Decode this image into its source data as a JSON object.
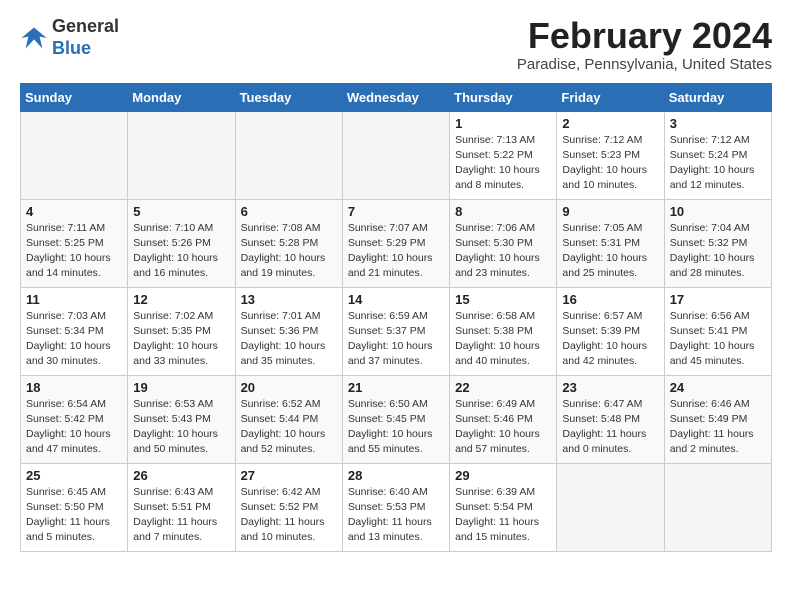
{
  "header": {
    "logo_line1": "General",
    "logo_line2": "Blue",
    "month": "February 2024",
    "location": "Paradise, Pennsylvania, United States"
  },
  "days_of_week": [
    "Sunday",
    "Monday",
    "Tuesday",
    "Wednesday",
    "Thursday",
    "Friday",
    "Saturday"
  ],
  "weeks": [
    [
      {
        "num": "",
        "info": "",
        "empty": true
      },
      {
        "num": "",
        "info": "",
        "empty": true
      },
      {
        "num": "",
        "info": "",
        "empty": true
      },
      {
        "num": "",
        "info": "",
        "empty": true
      },
      {
        "num": "1",
        "info": "Sunrise: 7:13 AM\nSunset: 5:22 PM\nDaylight: 10 hours\nand 8 minutes."
      },
      {
        "num": "2",
        "info": "Sunrise: 7:12 AM\nSunset: 5:23 PM\nDaylight: 10 hours\nand 10 minutes."
      },
      {
        "num": "3",
        "info": "Sunrise: 7:12 AM\nSunset: 5:24 PM\nDaylight: 10 hours\nand 12 minutes."
      }
    ],
    [
      {
        "num": "4",
        "info": "Sunrise: 7:11 AM\nSunset: 5:25 PM\nDaylight: 10 hours\nand 14 minutes."
      },
      {
        "num": "5",
        "info": "Sunrise: 7:10 AM\nSunset: 5:26 PM\nDaylight: 10 hours\nand 16 minutes."
      },
      {
        "num": "6",
        "info": "Sunrise: 7:08 AM\nSunset: 5:28 PM\nDaylight: 10 hours\nand 19 minutes."
      },
      {
        "num": "7",
        "info": "Sunrise: 7:07 AM\nSunset: 5:29 PM\nDaylight: 10 hours\nand 21 minutes."
      },
      {
        "num": "8",
        "info": "Sunrise: 7:06 AM\nSunset: 5:30 PM\nDaylight: 10 hours\nand 23 minutes."
      },
      {
        "num": "9",
        "info": "Sunrise: 7:05 AM\nSunset: 5:31 PM\nDaylight: 10 hours\nand 25 minutes."
      },
      {
        "num": "10",
        "info": "Sunrise: 7:04 AM\nSunset: 5:32 PM\nDaylight: 10 hours\nand 28 minutes."
      }
    ],
    [
      {
        "num": "11",
        "info": "Sunrise: 7:03 AM\nSunset: 5:34 PM\nDaylight: 10 hours\nand 30 minutes."
      },
      {
        "num": "12",
        "info": "Sunrise: 7:02 AM\nSunset: 5:35 PM\nDaylight: 10 hours\nand 33 minutes."
      },
      {
        "num": "13",
        "info": "Sunrise: 7:01 AM\nSunset: 5:36 PM\nDaylight: 10 hours\nand 35 minutes."
      },
      {
        "num": "14",
        "info": "Sunrise: 6:59 AM\nSunset: 5:37 PM\nDaylight: 10 hours\nand 37 minutes."
      },
      {
        "num": "15",
        "info": "Sunrise: 6:58 AM\nSunset: 5:38 PM\nDaylight: 10 hours\nand 40 minutes."
      },
      {
        "num": "16",
        "info": "Sunrise: 6:57 AM\nSunset: 5:39 PM\nDaylight: 10 hours\nand 42 minutes."
      },
      {
        "num": "17",
        "info": "Sunrise: 6:56 AM\nSunset: 5:41 PM\nDaylight: 10 hours\nand 45 minutes."
      }
    ],
    [
      {
        "num": "18",
        "info": "Sunrise: 6:54 AM\nSunset: 5:42 PM\nDaylight: 10 hours\nand 47 minutes."
      },
      {
        "num": "19",
        "info": "Sunrise: 6:53 AM\nSunset: 5:43 PM\nDaylight: 10 hours\nand 50 minutes."
      },
      {
        "num": "20",
        "info": "Sunrise: 6:52 AM\nSunset: 5:44 PM\nDaylight: 10 hours\nand 52 minutes."
      },
      {
        "num": "21",
        "info": "Sunrise: 6:50 AM\nSunset: 5:45 PM\nDaylight: 10 hours\nand 55 minutes."
      },
      {
        "num": "22",
        "info": "Sunrise: 6:49 AM\nSunset: 5:46 PM\nDaylight: 10 hours\nand 57 minutes."
      },
      {
        "num": "23",
        "info": "Sunrise: 6:47 AM\nSunset: 5:48 PM\nDaylight: 11 hours\nand 0 minutes."
      },
      {
        "num": "24",
        "info": "Sunrise: 6:46 AM\nSunset: 5:49 PM\nDaylight: 11 hours\nand 2 minutes."
      }
    ],
    [
      {
        "num": "25",
        "info": "Sunrise: 6:45 AM\nSunset: 5:50 PM\nDaylight: 11 hours\nand 5 minutes."
      },
      {
        "num": "26",
        "info": "Sunrise: 6:43 AM\nSunset: 5:51 PM\nDaylight: 11 hours\nand 7 minutes."
      },
      {
        "num": "27",
        "info": "Sunrise: 6:42 AM\nSunset: 5:52 PM\nDaylight: 11 hours\nand 10 minutes."
      },
      {
        "num": "28",
        "info": "Sunrise: 6:40 AM\nSunset: 5:53 PM\nDaylight: 11 hours\nand 13 minutes."
      },
      {
        "num": "29",
        "info": "Sunrise: 6:39 AM\nSunset: 5:54 PM\nDaylight: 11 hours\nand 15 minutes."
      },
      {
        "num": "",
        "info": "",
        "empty": true
      },
      {
        "num": "",
        "info": "",
        "empty": true
      }
    ]
  ]
}
